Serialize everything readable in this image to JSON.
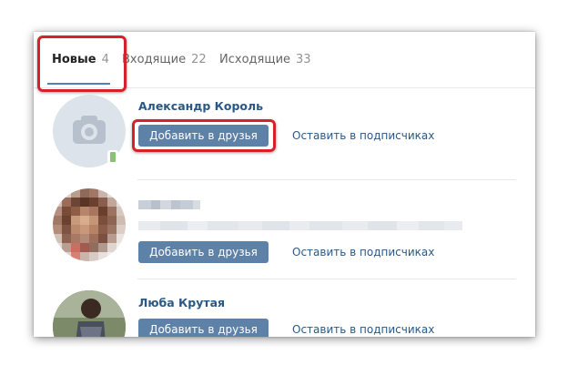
{
  "tabs": [
    {
      "label": "Новые",
      "count": "4"
    },
    {
      "label": "Входящие",
      "count": "22"
    },
    {
      "label": "Исходящие",
      "count": "33"
    }
  ],
  "requests": [
    {
      "name": "Александр Король",
      "add_label": "Добавить в друзья",
      "follow_label": "Оставить в подписчиках"
    },
    {
      "name": "",
      "add_label": "Добавить в друзья",
      "follow_label": "Оставить в подписчиках"
    },
    {
      "name": "Люба Крутая",
      "add_label": "Добавить в друзья",
      "follow_label": "Оставить в подписчиках"
    }
  ],
  "colors": {
    "accent": "#5181b8",
    "button": "#5e81a8",
    "link": "#2a5885",
    "highlight": "#d6202a",
    "online_mobile": "#8ac176"
  },
  "icons": {
    "avatar_placeholder": "camera-icon",
    "online_status": "mobile-online-icon"
  }
}
